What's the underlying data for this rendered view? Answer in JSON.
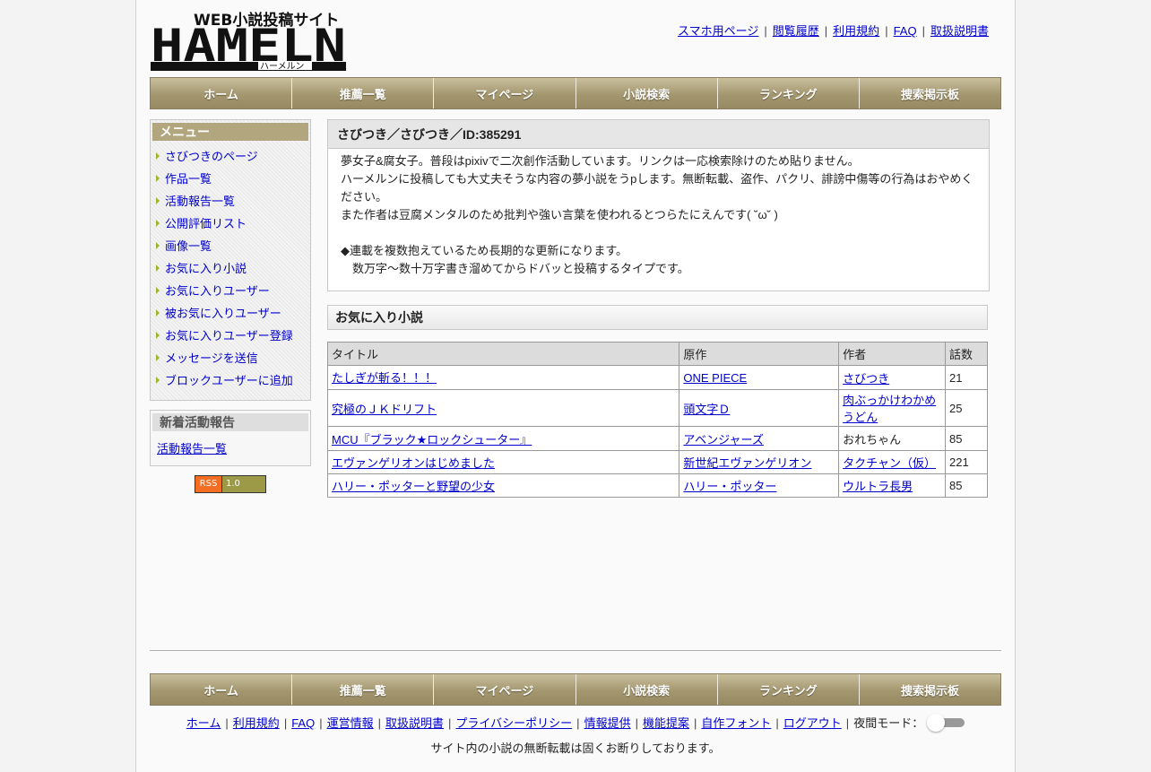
{
  "logo": {
    "top_text": "WEB小説投稿サイト",
    "main_text": "HAMELN",
    "kana": "ハーメルン"
  },
  "top_links": [
    "スマホ用ページ",
    "閲覧履歴",
    "利用規約",
    "FAQ",
    "取扱説明書"
  ],
  "nav": [
    "ホーム",
    "推薦一覧",
    "マイページ",
    "小説検索",
    "ランキング",
    "捜索掲示板"
  ],
  "menu": {
    "title": "メニュー",
    "items": [
      "さびつきのページ",
      "作品一覧",
      "活動報告一覧",
      "公開評価リスト",
      "画像一覧",
      "お気に入り小説",
      "お気に入りユーザー",
      "被お気に入りユーザー",
      "お気に入りユーザー登録",
      "メッセージを送信",
      "ブロックユーザーに追加"
    ]
  },
  "news": {
    "title": "新着活動報告",
    "link": "活動報告一覧"
  },
  "rss": {
    "left": "RSS",
    "right": "1.0"
  },
  "profile": {
    "title": "さびつき／さびつき／ID:385291",
    "lines": [
      "夢女子&腐女子。普段はpixivで二次創作活動しています。リンクは一応検索除けのため貼りません。",
      "ハーメルンに投稿しても大丈夫そうな内容の夢小説をうpします。無断転載、盗作、パクリ、誹謗中傷等の行為はおやめください。",
      "また作者は豆腐メンタルのため批判や強い言葉を使われるとつらたにえんです( ˘ω˘ )",
      "",
      "◆連載を複数抱えているため長期的な更新になります。"
    ],
    "indent_line": "数万字〜数十万字書き溜めてからドバッと投稿するタイプです。"
  },
  "favorites": {
    "heading": "お気に入り小説",
    "columns": [
      "タイトル",
      "原作",
      "作者",
      "話数"
    ],
    "rows": [
      {
        "title": "たしぎが斬る！！！",
        "original": "ONE PIECE",
        "author": "さびつき",
        "author_link": true,
        "episodes": "21"
      },
      {
        "title": "究極のＪＫドリフト",
        "original": "頭文字Ｄ",
        "author": "肉ぶっかけわかめうどん",
        "author_link": true,
        "episodes": "25"
      },
      {
        "title": "MCU『ブラック★ロックシューター』",
        "original": "アベンジャーズ",
        "author": "おれちゃん",
        "author_link": false,
        "episodes": "85"
      },
      {
        "title": "エヴァンゲリオンはじめました",
        "original": "新世紀エヴァンゲリオン",
        "author": "タクチャン（仮）",
        "author_link": true,
        "episodes": "221"
      },
      {
        "title": "ハリー・ポッターと野望の少女",
        "original": "ハリー・ポッター",
        "author": "ウルトラ長男",
        "author_link": true,
        "episodes": "85"
      }
    ]
  },
  "footer": {
    "links": [
      "ホーム",
      "利用規約",
      "FAQ",
      "運営情報",
      "取扱説明書",
      "プライバシーポリシー",
      "情報提供",
      "機能提案",
      "自作フォント",
      "ログアウト"
    ],
    "night_mode_label": "夜間モード：",
    "notice": "サイト内の小説の無断転載は固くお断りしております。"
  },
  "colors": {
    "nav_gold": "#a49770",
    "menu_title": "#b2a67e",
    "link": "#0000cc",
    "rss_orange": "#f36d23"
  }
}
